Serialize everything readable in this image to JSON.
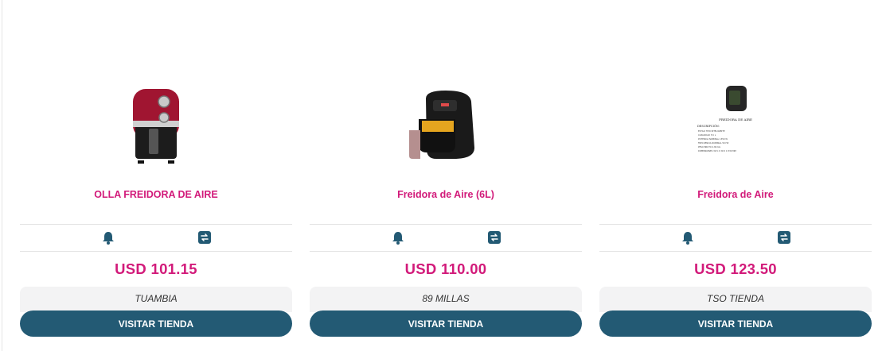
{
  "products": [
    {
      "name": "OLLA FREIDORA DE AIRE",
      "price": "USD 101.15",
      "store": "TUAMBIA",
      "visit_label": "VISITAR TIENDA",
      "image_icon": "red-air-fryer-image"
    },
    {
      "name": "Freidora de Aire (6L)",
      "price": "USD 110.00",
      "store": "89 MILLAS",
      "visit_label": "VISITAR TIENDA",
      "image_icon": "black-air-fryer-image"
    },
    {
      "name": "Freidora de Aire",
      "price": "USD 123.50",
      "store": "TSO TIENDA",
      "visit_label": "VISITAR TIENDA",
      "image_icon": "air-fryer-spec-sheet-image",
      "image_text": {
        "heading": "FREIDORA DE AIRE",
        "subheading": "DESCRIPCIÓN:",
        "bullets": [
          "ESTILO TIPO INTELIGENTE",
          "CAPACIDAD 5.5 L",
          "POTENCIA NOMINAL 1350 W",
          "FRECUENCIA NOMINAL 50 HZ",
          "PESO BRUTO 2.84 KG",
          "DIMENSIONES 30.5 X 30.5 X 330 MM"
        ]
      }
    }
  ],
  "colors": {
    "accent_pink": "#d21a7a",
    "button_blue": "#235a74",
    "store_bg": "#f3f3f4"
  },
  "icons": {
    "alert": "bell-icon",
    "compare": "compare-icon"
  }
}
